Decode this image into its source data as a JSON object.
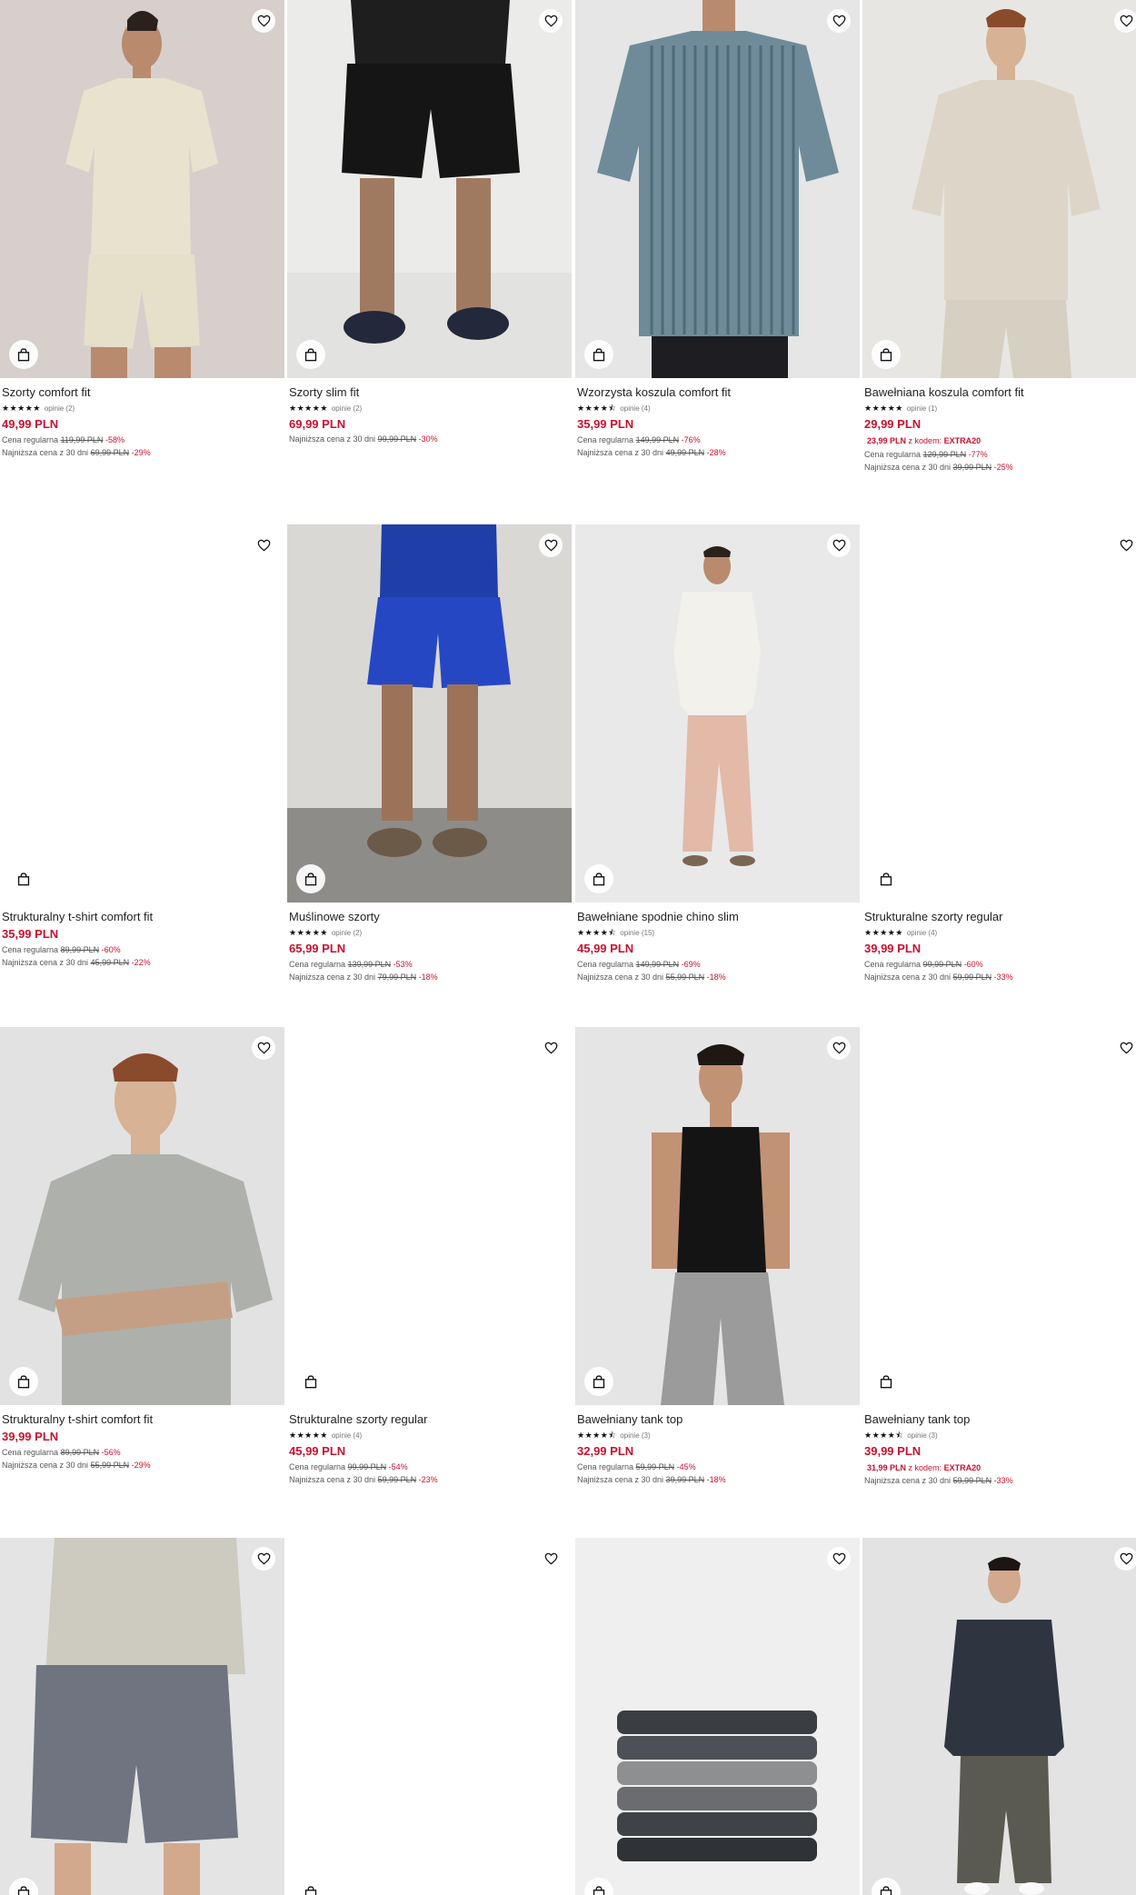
{
  "products": [
    {
      "title": "Szorty comfort fit",
      "stars": "★★★★★",
      "reviews": "opinie (2)",
      "price": "49,99 PLN",
      "code_price": "",
      "code_label": "",
      "code": "",
      "regular_label": "Cena regularna",
      "regular_price": "119,99 PLN",
      "regular_pct": "-58%",
      "lowest_label": "Najniższa cena z 30 dni",
      "lowest_price": "69,99 PLN",
      "lowest_pct": "-29%"
    },
    {
      "title": "Szorty slim fit",
      "stars": "★★★★★",
      "reviews": "opinie (2)",
      "price": "69,99 PLN",
      "code_price": "",
      "code_label": "",
      "code": "",
      "regular_label": "",
      "regular_price": "",
      "regular_pct": "",
      "lowest_label": "Najniższa cena z 30 dni",
      "lowest_price": "99,99 PLN",
      "lowest_pct": "-30%"
    },
    {
      "title": "Wzorzysta koszula comfort fit",
      "stars": "★★★★⯪",
      "reviews": "opinie (4)",
      "price": "35,99 PLN",
      "code_price": "",
      "code_label": "",
      "code": "",
      "regular_label": "Cena regularna",
      "regular_price": "149,99 PLN",
      "regular_pct": "-76%",
      "lowest_label": "Najniższa cena z 30 dni",
      "lowest_price": "49,99 PLN",
      "lowest_pct": "-28%"
    },
    {
      "title": "Bawełniana koszula comfort fit",
      "stars": "★★★★★",
      "reviews": "opinie (1)",
      "price": "29,99 PLN",
      "code_price": "23,99 PLN",
      "code_label": "z kodem:",
      "code": "EXTRA20",
      "regular_label": "Cena regularna",
      "regular_price": "129,99 PLN",
      "regular_pct": "-77%",
      "lowest_label": "Najniższa cena z 30 dni",
      "lowest_price": "39,99 PLN",
      "lowest_pct": "-25%"
    },
    {
      "title": "Strukturalny t-shirt comfort fit",
      "stars": "",
      "reviews": "",
      "price": "35,99 PLN",
      "code_price": "",
      "code_label": "",
      "code": "",
      "regular_label": "Cena regularna",
      "regular_price": "89,99 PLN",
      "regular_pct": "-60%",
      "lowest_label": "Najniższa cena z 30 dni",
      "lowest_price": "45,99 PLN",
      "lowest_pct": "-22%"
    },
    {
      "title": "Muślinowe szorty",
      "stars": "★★★★★",
      "reviews": "opinie (2)",
      "price": "65,99 PLN",
      "code_price": "",
      "code_label": "",
      "code": "",
      "regular_label": "Cena regularna",
      "regular_price": "139,99 PLN",
      "regular_pct": "-53%",
      "lowest_label": "Najniższa cena z 30 dni",
      "lowest_price": "79,99 PLN",
      "lowest_pct": "-18%"
    },
    {
      "title": "Bawełniane spodnie chino slim",
      "stars": "★★★★⯪",
      "reviews": "opinie (15)",
      "price": "45,99 PLN",
      "code_price": "",
      "code_label": "",
      "code": "",
      "regular_label": "Cena regularna",
      "regular_price": "149,99 PLN",
      "regular_pct": "-69%",
      "lowest_label": "Najniższa cena z 30 dni",
      "lowest_price": "55,99 PLN",
      "lowest_pct": "-18%"
    },
    {
      "title": "Strukturalne szorty regular",
      "stars": "★★★★★",
      "reviews": "opinie (4)",
      "price": "39,99 PLN",
      "code_price": "",
      "code_label": "",
      "code": "",
      "regular_label": "Cena regularna",
      "regular_price": "99,99 PLN",
      "regular_pct": "-60%",
      "lowest_label": "Najniższa cena z 30 dni",
      "lowest_price": "59,99 PLN",
      "lowest_pct": "-33%"
    },
    {
      "title": "Strukturalny t-shirt comfort fit",
      "stars": "",
      "reviews": "",
      "price": "39,99 PLN",
      "code_price": "",
      "code_label": "",
      "code": "",
      "regular_label": "Cena regularna",
      "regular_price": "89,99 PLN",
      "regular_pct": "-56%",
      "lowest_label": "Najniższa cena z 30 dni",
      "lowest_price": "55,99 PLN",
      "lowest_pct": "-29%"
    },
    {
      "title": "Strukturalne szorty regular",
      "stars": "★★★★★",
      "reviews": "opinie (4)",
      "price": "45,99 PLN",
      "code_price": "",
      "code_label": "",
      "code": "",
      "regular_label": "Cena regularna",
      "regular_price": "99,99 PLN",
      "regular_pct": "-54%",
      "lowest_label": "Najniższa cena z 30 dni",
      "lowest_price": "59,99 PLN",
      "lowest_pct": "-23%"
    },
    {
      "title": "Bawełniany tank top",
      "stars": "★★★★⯪",
      "reviews": "opinie (3)",
      "price": "32,99 PLN",
      "code_price": "",
      "code_label": "",
      "code": "",
      "regular_label": "Cena regularna",
      "regular_price": "59,99 PLN",
      "regular_pct": "-45%",
      "lowest_label": "Najniższa cena z 30 dni",
      "lowest_price": "39,99 PLN",
      "lowest_pct": "-18%"
    },
    {
      "title": "Bawełniany tank top",
      "stars": "★★★★⯪",
      "reviews": "opinie (3)",
      "price": "39,99 PLN",
      "code_price": "31,99 PLN",
      "code_label": "z kodem:",
      "code": "EXTRA20",
      "regular_label": "",
      "regular_price": "",
      "regular_pct": "",
      "lowest_label": "Najniższa cena z 30 dni",
      "lowest_price": "59,99 PLN",
      "lowest_pct": "-33%"
    },
    {
      "title": "",
      "stars": "",
      "reviews": "",
      "price": "",
      "code_price": "",
      "code_label": "",
      "code": "",
      "regular_label": "",
      "regular_price": "",
      "regular_pct": "",
      "lowest_label": "",
      "lowest_price": "",
      "lowest_pct": ""
    },
    {
      "title": "",
      "stars": "",
      "reviews": "",
      "price": "",
      "code_price": "",
      "code_label": "",
      "code": "",
      "regular_label": "",
      "regular_price": "",
      "regular_pct": "",
      "lowest_label": "",
      "lowest_price": "",
      "lowest_pct": ""
    },
    {
      "title": "",
      "stars": "",
      "reviews": "",
      "price": "",
      "code_price": "",
      "code_label": "",
      "code": "",
      "regular_label": "",
      "regular_price": "",
      "regular_pct": "",
      "lowest_label": "",
      "lowest_price": "",
      "lowest_pct": ""
    },
    {
      "title": "",
      "stars": "",
      "reviews": "",
      "price": "",
      "code_price": "",
      "code_label": "",
      "code": "",
      "regular_label": "",
      "regular_price": "",
      "regular_pct": "",
      "lowest_label": "",
      "lowest_price": "",
      "lowest_pct": ""
    }
  ],
  "icons": {
    "wishlist": "heart-outline-icon",
    "cart": "shopping-bag-icon"
  },
  "colors": {
    "price": "#c8102e",
    "text": "#222222",
    "muted": "#555555",
    "image_bg": "#ececec"
  }
}
